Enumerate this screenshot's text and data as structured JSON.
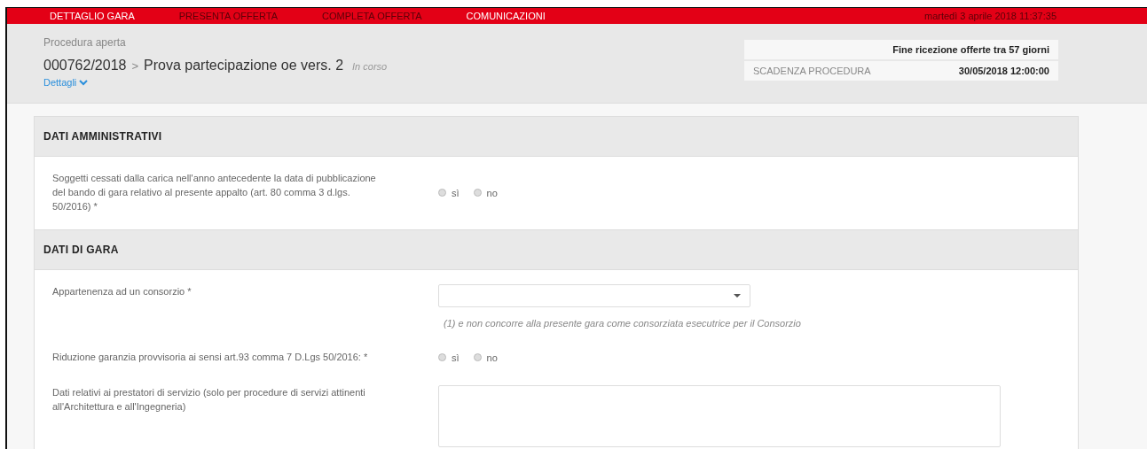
{
  "nav": {
    "tabs": [
      {
        "label": "DETTAGLIO GARA",
        "disabled": false
      },
      {
        "label": "PRESENTA OFFERTA",
        "disabled": true
      },
      {
        "label": "COMPLETA OFFERTA",
        "disabled": true
      },
      {
        "label": "COMUNICAZIONI",
        "disabled": false
      }
    ],
    "datetime": "martedì 3 aprile 2018 11:37:35"
  },
  "header": {
    "procedure_type": "Procedura aperta",
    "code": "000762/2018",
    "separator": ">",
    "title": "Prova partecipazione oe vers. 2",
    "status": "In corso",
    "details_link": "Dettagli",
    "deadline_notice": "Fine ricezione offerte tra 57 giorni",
    "deadline_label": "SCADENZA PROCEDURA",
    "deadline_value": "30/05/2018 12:00:00"
  },
  "sections": [
    {
      "title": "DATI AMMINISTRATIVI",
      "fields": [
        {
          "kind": "radio",
          "label": "Soggetti cessati dalla carica nell'anno antecedente la data di pubblicazione del bando di gara relativo al presente appalto (art. 80 comma 3 d.lgs. 50/2016) *",
          "options": [
            {
              "label": "sì",
              "selected": false
            },
            {
              "label": "no",
              "selected": false
            }
          ]
        }
      ]
    },
    {
      "title": "DATI DI GARA",
      "fields": [
        {
          "kind": "select",
          "label": "Appartenenza ad un consorzio *",
          "hint": "(1) e non concorre alla presente gara come consorziata esecutrice per il Consorzio"
        },
        {
          "kind": "radio",
          "label": "Riduzione garanzia provvisoria ai sensi art.93 comma 7 D.Lgs 50/2016: *",
          "options": [
            {
              "label": "sì",
              "selected": false
            },
            {
              "label": "no",
              "selected": false
            }
          ]
        },
        {
          "kind": "textarea",
          "label": "Dati relativi ai prestatori di servizio (solo per procedure di servizi attinenti all'Architettura e all'Ingegneria)"
        }
      ]
    }
  ]
}
